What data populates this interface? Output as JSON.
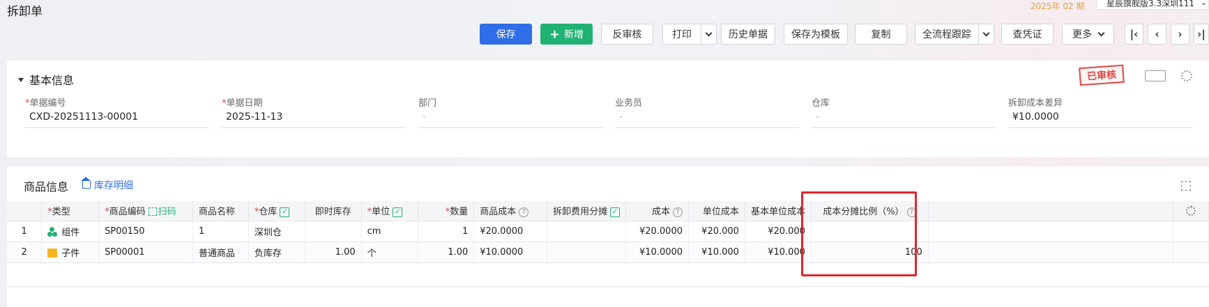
{
  "page_title": "拆卸单",
  "header": {
    "period": "2025年 02 期",
    "account": "星辰旗舰版3.3深圳111"
  },
  "toolbar": {
    "save": "保存",
    "add": "新增",
    "unaudit": "反审核",
    "print": "打印",
    "history": "历史单据",
    "save_template": "保存为模板",
    "copy": "复制",
    "trace": "全流程跟踪",
    "voucher": "查凭证",
    "more": "更多"
  },
  "basic_info": {
    "title": "基本信息",
    "stamp": "已审核",
    "fields": [
      {
        "label": "单据编号",
        "required": true,
        "value": "CXD-20251113-00001"
      },
      {
        "label": "单据日期",
        "required": true,
        "value": "2025-11-13"
      },
      {
        "label": "部门",
        "required": false,
        "value": "-"
      },
      {
        "label": "业务员",
        "required": false,
        "value": "-"
      },
      {
        "label": "仓库",
        "required": false,
        "value": "-"
      },
      {
        "label": "拆卸成本差异",
        "required": false,
        "value": "¥10.0000"
      }
    ]
  },
  "goods": {
    "title": "商品信息",
    "stock_link": "库存明细",
    "columns": {
      "type": "类型",
      "code": "商品编码",
      "scan": "扫码",
      "name": "商品名称",
      "warehouse": "仓库",
      "stock": "即时库存",
      "unit": "单位",
      "qty": "数量",
      "goods_cost": "商品成本",
      "fee_alloc": "拆卸费用分摊",
      "cost": "成本",
      "unit_cost": "单位成本",
      "base_unit_cost": "基本单位成本",
      "alloc_ratio": "成本分摊比例（%）"
    },
    "rows": [
      {
        "no": "1",
        "type": "组件",
        "type_icon": "combo-icon",
        "code": "SP00150",
        "name": "1",
        "warehouse": "深圳仓",
        "stock": "",
        "unit": "cm",
        "qty": "1",
        "goods_cost": "¥20.0000",
        "fee_alloc": "",
        "cost": "¥20.0000",
        "unit_cost": "¥20.000",
        "base_unit_cost": "¥20.000",
        "alloc_ratio": ""
      },
      {
        "no": "2",
        "type": "子件",
        "type_icon": "box-icon",
        "code": "SP00001",
        "name": "普通商品",
        "warehouse": "负库存",
        "stock": "1.00",
        "unit": "个",
        "qty": "1.00",
        "goods_cost": "¥10.0000",
        "fee_alloc": "",
        "cost": "¥10.0000",
        "unit_cost": "¥10.000",
        "base_unit_cost": "¥10.000",
        "alloc_ratio": "100"
      }
    ]
  },
  "colors": {
    "primary": "#2f6ee8",
    "success": "#20b273",
    "danger": "#e0262d"
  }
}
